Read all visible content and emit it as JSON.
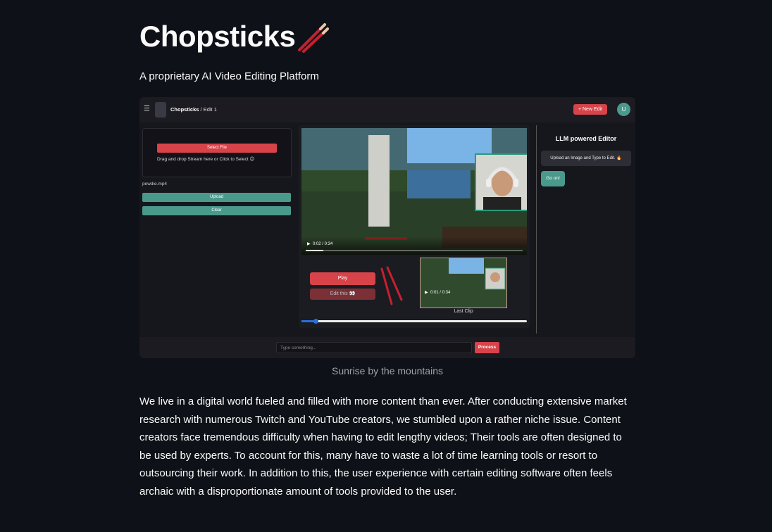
{
  "header": {
    "title": "Chopsticks",
    "subtitle": "A proprietary AI Video Editing Platform"
  },
  "screenshot": {
    "breadcrumb_app": "Chopsticks",
    "breadcrumb_sep": " / ",
    "breadcrumb_page": "Edit 1",
    "new_edit_label": "+ New Edit",
    "user_initial": "U",
    "select_file_label": "Select File",
    "drag_drop_text": "Drag and drop Stream here or Click to Select 😊",
    "file_name": "pewdie.mp4",
    "upload_label": "Upload",
    "clear_label": "Clear",
    "video_time": "0:02 / 0:34",
    "play_label": "Play",
    "edit_this_label": "Edit this 👀",
    "clip_time": "0:01 / 0:34",
    "last_clip_label": "Last Clip",
    "llm_title": "LLM powered Editor",
    "llm_message": "Upload an Image and Type to Edit. 🔥",
    "go_label": "Go on!",
    "type_placeholder": "Type something...",
    "process_label": "Process"
  },
  "caption": "Sunrise by the mountains",
  "paragraph": "We live in a digital world fueled and filled with more content than ever. After conducting extensive market research with numerous Twitch and YouTube creators, we stumbled upon a rather niche issue. Content creators face tremendous difficulty when having to edit lengthy videos; Their tools are often designed to be used by experts. To account for this, many have to waste a lot of time learning tools or resort to outsourcing their work. In addition to this, the user experience with certain editing software often feels archaic with a disproportionate amount of tools provided to the user.",
  "icons": {
    "title_emoji": "chopsticks-icon",
    "menu": "hamburger-menu-icon"
  },
  "colors": {
    "background": "#0e1117",
    "accent_red": "#d8434a",
    "accent_teal": "#4a9a8c",
    "slider_blue": "#2a6fd6"
  }
}
